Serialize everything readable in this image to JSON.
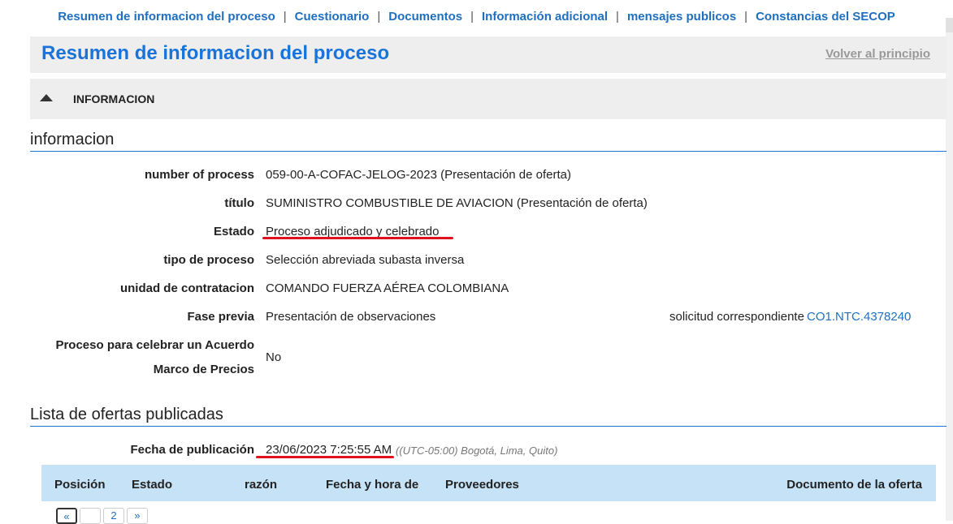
{
  "topnav": {
    "items": [
      "Resumen de informacion del proceso",
      "Cuestionario",
      "Documentos",
      "Información adicional",
      "mensajes publicos",
      "Constancias del SECOP"
    ]
  },
  "titlebar": {
    "title": "Resumen de informacion del proceso",
    "back_link": "Volver al principio"
  },
  "section": {
    "label": "INFORMACION"
  },
  "info": {
    "heading": "informacion",
    "number_label": "number of process",
    "number_value": "059-00-A-COFAC-JELOG-2023 (Presentación de oferta)",
    "titulo_label": "título",
    "titulo_value": "SUMINISTRO COMBUSTIBLE DE AVIACION (Presentación de oferta)",
    "estado_label": "Estado",
    "estado_value": "Proceso adjudicado y celebrado",
    "tipo_label": "tipo de proceso",
    "tipo_value": "Selección abreviada subasta inversa",
    "unidad_label": "unidad de contratacion",
    "unidad_value": "COMANDO FUERZA AÉREA COLOMBIANA",
    "fase_label": "Fase previa",
    "fase_value": "Presentación de observaciones",
    "solicitud_label": "solicitud correspondiente",
    "solicitud_value": "CO1.NTC.4378240",
    "acuerdo_label_1": "Proceso para celebrar un Acuerdo",
    "acuerdo_label_2": "Marco de Precios",
    "acuerdo_value": "No"
  },
  "ofertas": {
    "heading": "Lista de ofertas publicadas",
    "fecha_label": "Fecha de publicación",
    "fecha_value": "23/06/2023 7:25:55 AM",
    "timezone": "((UTC-05:00) Bogotá, Lima, Quito)",
    "columns": [
      "Posición",
      "Estado",
      "razón",
      "Fecha y hora de",
      "Proveedores",
      "Documento de la oferta"
    ],
    "pagination": [
      "«",
      "",
      "2",
      "»"
    ]
  },
  "colors": {
    "link": "#1f6fbf",
    "title": "#1a73d9",
    "header_bg": "#c5e2f6",
    "highlight": "#e0101c"
  }
}
